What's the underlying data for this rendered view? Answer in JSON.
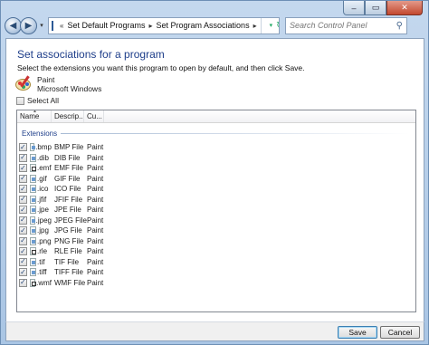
{
  "window": {
    "minimize_glyph": "–",
    "maximize_glyph": "▭",
    "close_glyph": "✕"
  },
  "nav": {
    "back_glyph": "◀",
    "forward_glyph": "▶",
    "drop_glyph": "▾",
    "crumb_sep": "«",
    "crumbs": [
      "Set Default Programs",
      "Set Program Associations"
    ],
    "refresh_glyph": "↻",
    "search_placeholder": "Search Control Panel",
    "search_glyph": "⚲"
  },
  "main": {
    "heading": "Set associations for a program",
    "instructions": "Select the extensions you want this program to open by default, and then click Save.",
    "program_name": "Paint",
    "program_publisher": "Microsoft Windows",
    "select_all_label": "Select All"
  },
  "list": {
    "columns": [
      "Name",
      "Descrip...",
      "Cu..."
    ],
    "group_label": "Extensions",
    "rows": [
      {
        "ext": ".bmp",
        "desc": "BMP File",
        "current": "Paint",
        "icon": "pic"
      },
      {
        "ext": ".dib",
        "desc": "DIB File",
        "current": "Paint",
        "icon": "pic"
      },
      {
        "ext": ".emf",
        "desc": "EMF File",
        "current": "Paint",
        "icon": "doc"
      },
      {
        "ext": ".gif",
        "desc": "GIF File",
        "current": "Paint",
        "icon": "pic"
      },
      {
        "ext": ".ico",
        "desc": "ICO File",
        "current": "Paint",
        "icon": "pic"
      },
      {
        "ext": ".jfif",
        "desc": "JFIF File",
        "current": "Paint",
        "icon": "pic"
      },
      {
        "ext": ".jpe",
        "desc": "JPE File",
        "current": "Paint",
        "icon": "pic"
      },
      {
        "ext": ".jpeg",
        "desc": "JPEG File",
        "current": "Paint",
        "icon": "pic"
      },
      {
        "ext": ".jpg",
        "desc": "JPG File",
        "current": "Paint",
        "icon": "pic"
      },
      {
        "ext": ".png",
        "desc": "PNG File",
        "current": "Paint",
        "icon": "pic"
      },
      {
        "ext": ".rle",
        "desc": "RLE File",
        "current": "Paint",
        "icon": "doc"
      },
      {
        "ext": ".tif",
        "desc": "TIF File",
        "current": "Paint",
        "icon": "pic"
      },
      {
        "ext": ".tiff",
        "desc": "TIFF File",
        "current": "Paint",
        "icon": "pic"
      },
      {
        "ext": ".wmf",
        "desc": "WMF File",
        "current": "Paint",
        "icon": "doc"
      }
    ]
  },
  "buttons": {
    "save": "Save",
    "cancel": "Cancel"
  },
  "colors": {
    "heading": "#1e3e8a",
    "frame": "#b9d1ea"
  }
}
